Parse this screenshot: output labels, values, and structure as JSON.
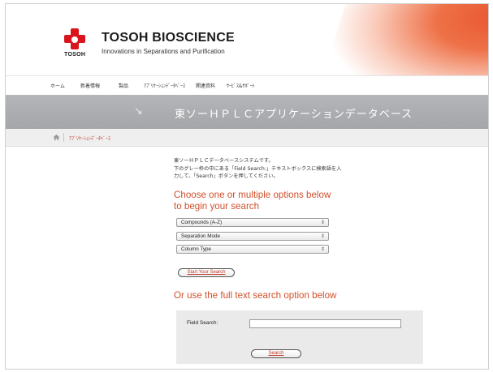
{
  "header": {
    "brand_title": "TOSOH BIOSCIENCE",
    "brand_subtitle": "Innovations in Separations and Purification",
    "logo_text": "TOSOH",
    "brand_color": "#d9141c",
    "accent_color": "#e9552f"
  },
  "nav": {
    "items": [
      {
        "label": "ホーム"
      },
      {
        "label": "新着情報"
      },
      {
        "label": "製品"
      },
      {
        "label": "ｱﾌﾟﾘｹｰｼｮﾝﾃﾞｰﾀﾍﾞｰｽ"
      },
      {
        "label": "関連資料"
      },
      {
        "label": "ｻｰﾋﾞｽ&ｻﾎﾟｰﾄ"
      }
    ]
  },
  "banner": {
    "arrow_icon": "arrow-down-right-icon",
    "title": "東ソーＨＰＬＣアプリケーションデータベース"
  },
  "breadcrumb": {
    "home_icon": "home-icon",
    "current": "ｱﾌﾟﾘｹｰｼｮﾝﾃﾞｰﾀﾍﾞｰｽ"
  },
  "content": {
    "intro_lines": [
      "東ソーＨＰＬＣデータベースシステムです。",
      "下のグレー枠の中にある「Field Search:」テキストボックスに検索語を入",
      "力して、「Search」ボタンを押してください。"
    ],
    "heading_options": "Choose one or multiple options below to begin your search",
    "selects": [
      {
        "value": "Compounds (A-Z)"
      },
      {
        "value": "Separation Mode"
      },
      {
        "value": "Column Type"
      }
    ],
    "select_chevron": "⇕",
    "start_button": "Start Your Search",
    "heading_fulltext": "Or use the full text search option below",
    "field_search_label": "Field Search:",
    "field_search_value": "",
    "search_button": "Search"
  }
}
